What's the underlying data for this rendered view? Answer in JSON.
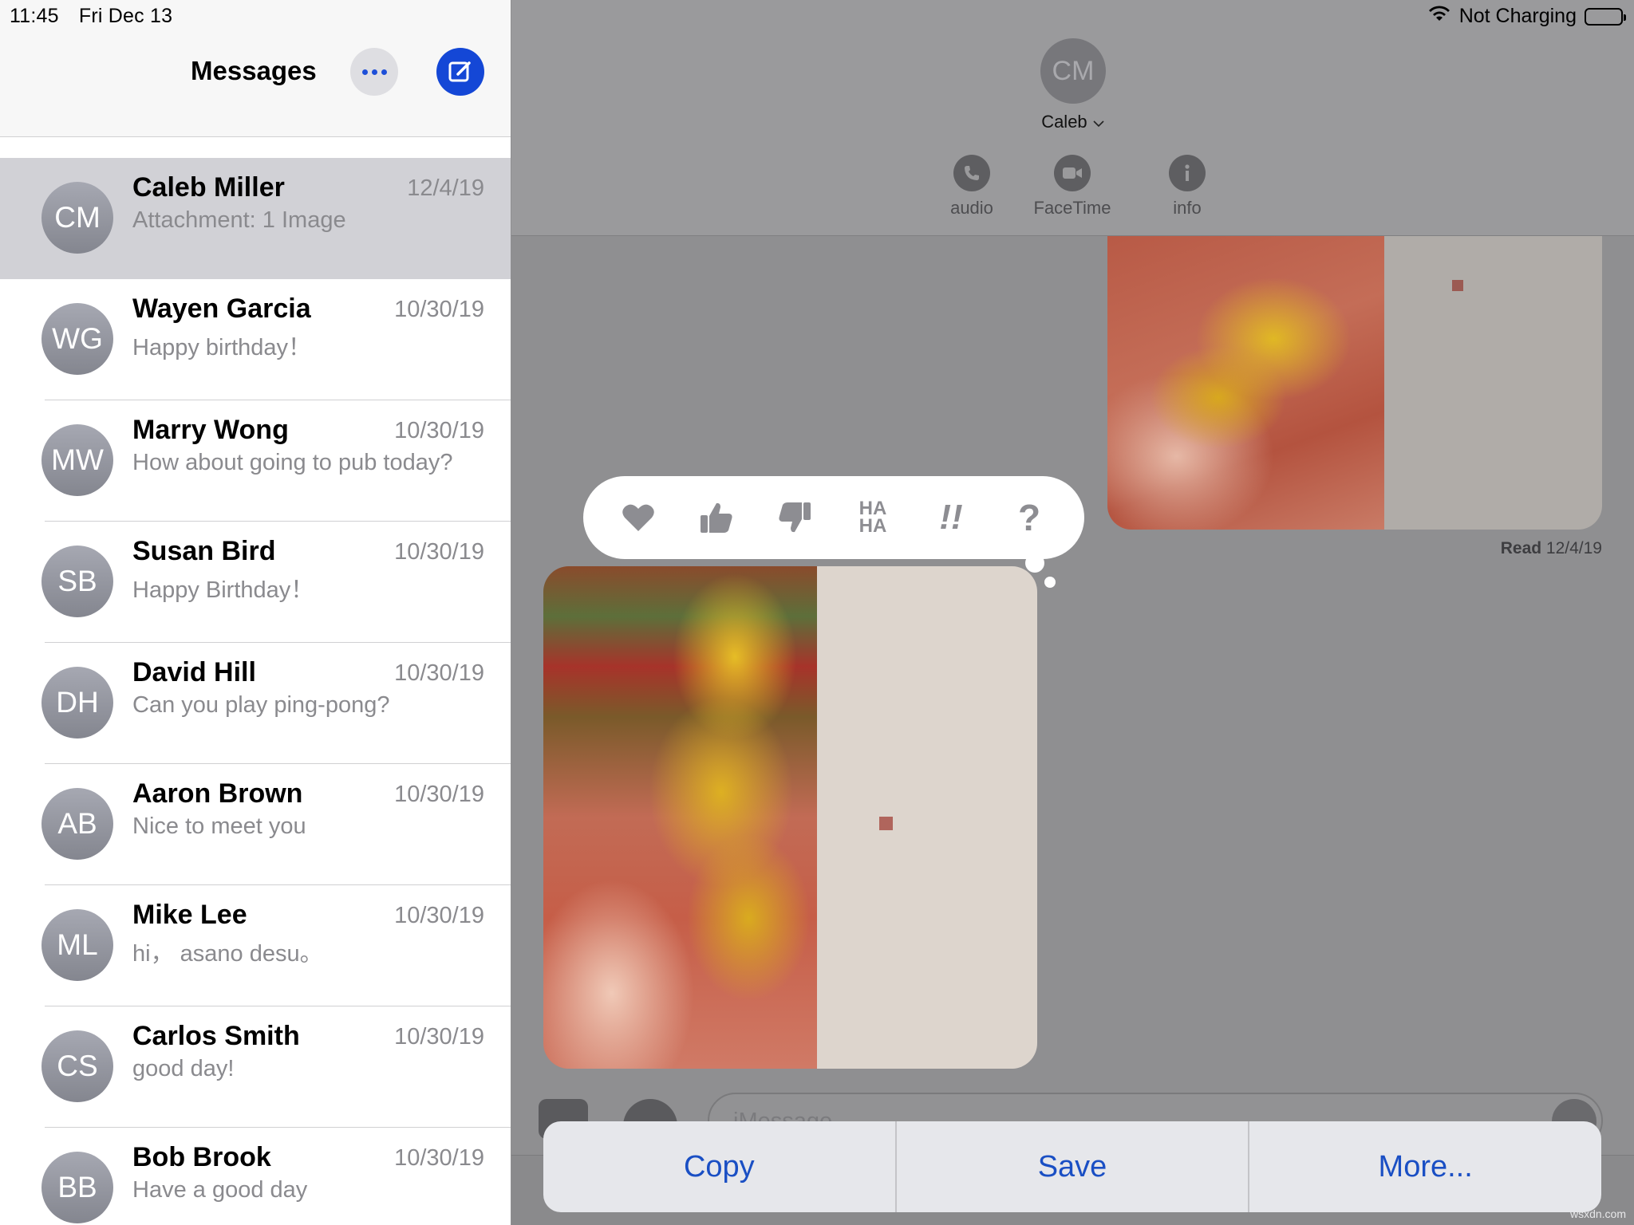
{
  "status": {
    "time": "11:45",
    "date": "Fri Dec 13",
    "charging": "Not Charging"
  },
  "sidebar": {
    "title": "Messages",
    "conversations": [
      {
        "initials": "CM",
        "name": "Caleb Miller",
        "date": "12/4/19",
        "preview": "Attachment: 1 Image"
      },
      {
        "initials": "WG",
        "name": "Wayen Garcia",
        "date": "10/30/19",
        "preview": "Happy birthday！"
      },
      {
        "initials": "MW",
        "name": "Marry Wong",
        "date": "10/30/19",
        "preview": "How about going to pub today?"
      },
      {
        "initials": "SB",
        "name": "Susan Bird",
        "date": "10/30/19",
        "preview": "Happy Birthday！"
      },
      {
        "initials": "DH",
        "name": "David Hill",
        "date": "10/30/19",
        "preview": "Can you play ping-pong?"
      },
      {
        "initials": "AB",
        "name": "Aaron Brown",
        "date": "10/30/19",
        "preview": "Nice to meet you"
      },
      {
        "initials": "ML",
        "name": "Mike Lee",
        "date": "10/30/19",
        "preview": "hi， asano desu。"
      },
      {
        "initials": "CS",
        "name": "Carlos Smith",
        "date": "10/30/19",
        "preview": "good day!"
      },
      {
        "initials": "BB",
        "name": "Bob Brook",
        "date": "10/30/19",
        "preview": "Have a good day"
      }
    ]
  },
  "chat": {
    "contact_initials": "CM",
    "contact_name": "Caleb",
    "actions": {
      "audio": "audio",
      "facetime": "FaceTime",
      "info": "info"
    },
    "read_label": "Read",
    "read_date": "12/4/19",
    "composer_placeholder": "iMessage",
    "tapbacks": {
      "haha": "HA HA",
      "exclaim": "!!",
      "question": "?"
    }
  },
  "action_sheet": {
    "copy": "Copy",
    "save": "Save",
    "more": "More..."
  },
  "watermark": "wsxdn.com",
  "colors": {
    "accent": "#1447d6",
    "selected_row": "#d1d1d6",
    "dim_overlay": "#8f8f91"
  }
}
